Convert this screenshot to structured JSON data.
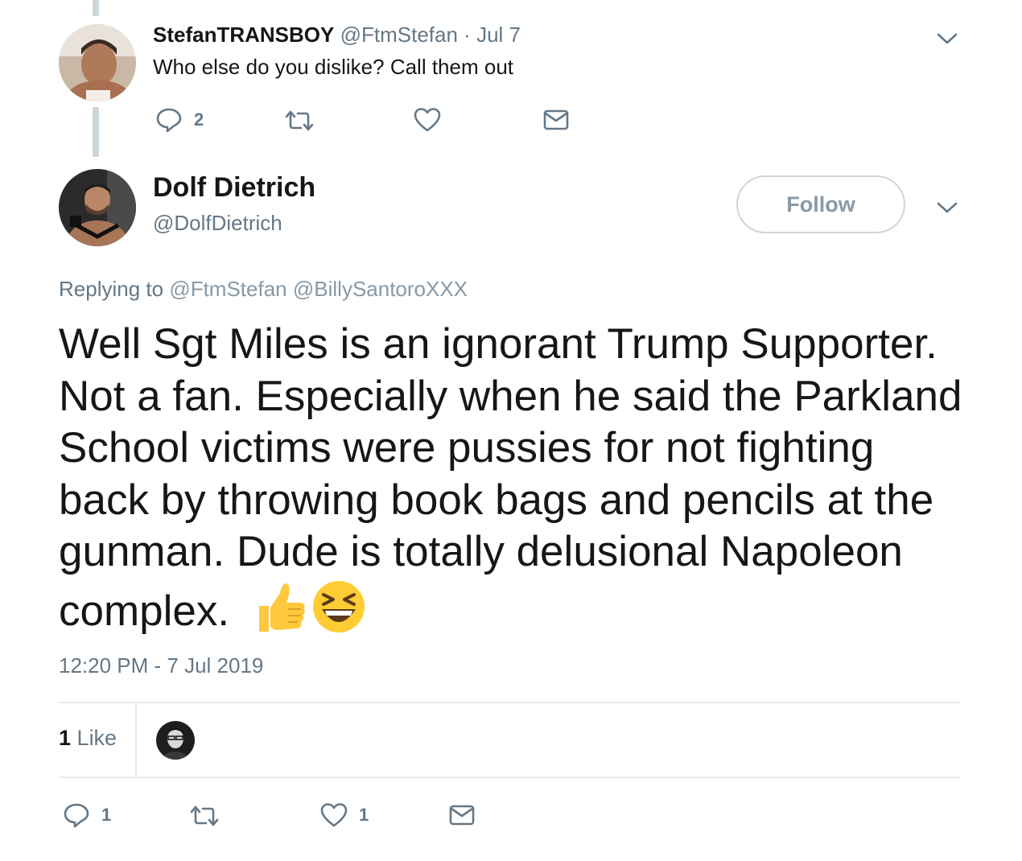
{
  "parent_tweet": {
    "display_name": "StefanTRANSBOY",
    "handle": "@FtmStefan",
    "separator": "·",
    "date": "Jul 7",
    "text": "Who else do you dislike? Call them out",
    "reply_count": "2",
    "retweet_count": "",
    "like_count": ""
  },
  "main_tweet": {
    "display_name": "Dolf Dietrich",
    "handle": "@DolfDietrich",
    "follow_label": "Follow",
    "replying_prefix": "Replying to",
    "replying_mentions": [
      "@FtmStefan",
      "@BillySantoroXXX"
    ],
    "text": "Well Sgt Miles is an ignorant Trump Supporter. Not a fan. Especially when he said the Parkland School victims were pussies for not fighting back by throwing book bags and pencils at the gunman. Dude is totally delusional Napoleon complex.",
    "emojis": [
      "thumbs-up-emoji",
      "grinning-squinting-face-emoji"
    ],
    "timestamp": "12:20 PM - 7 Jul 2019",
    "likes_summary_count": "1",
    "likes_summary_label": "Like",
    "reply_count": "1",
    "retweet_count": "",
    "like_count": "1"
  },
  "icons": {
    "reply": "reply-icon",
    "retweet": "retweet-icon",
    "like": "heart-icon",
    "dm": "envelope-icon",
    "menu": "chevron-down-icon"
  },
  "colors": {
    "text_primary": "#14171a",
    "text_secondary": "#657786",
    "border": "#e6ecf0",
    "thread_line": "#ccd6dd"
  }
}
